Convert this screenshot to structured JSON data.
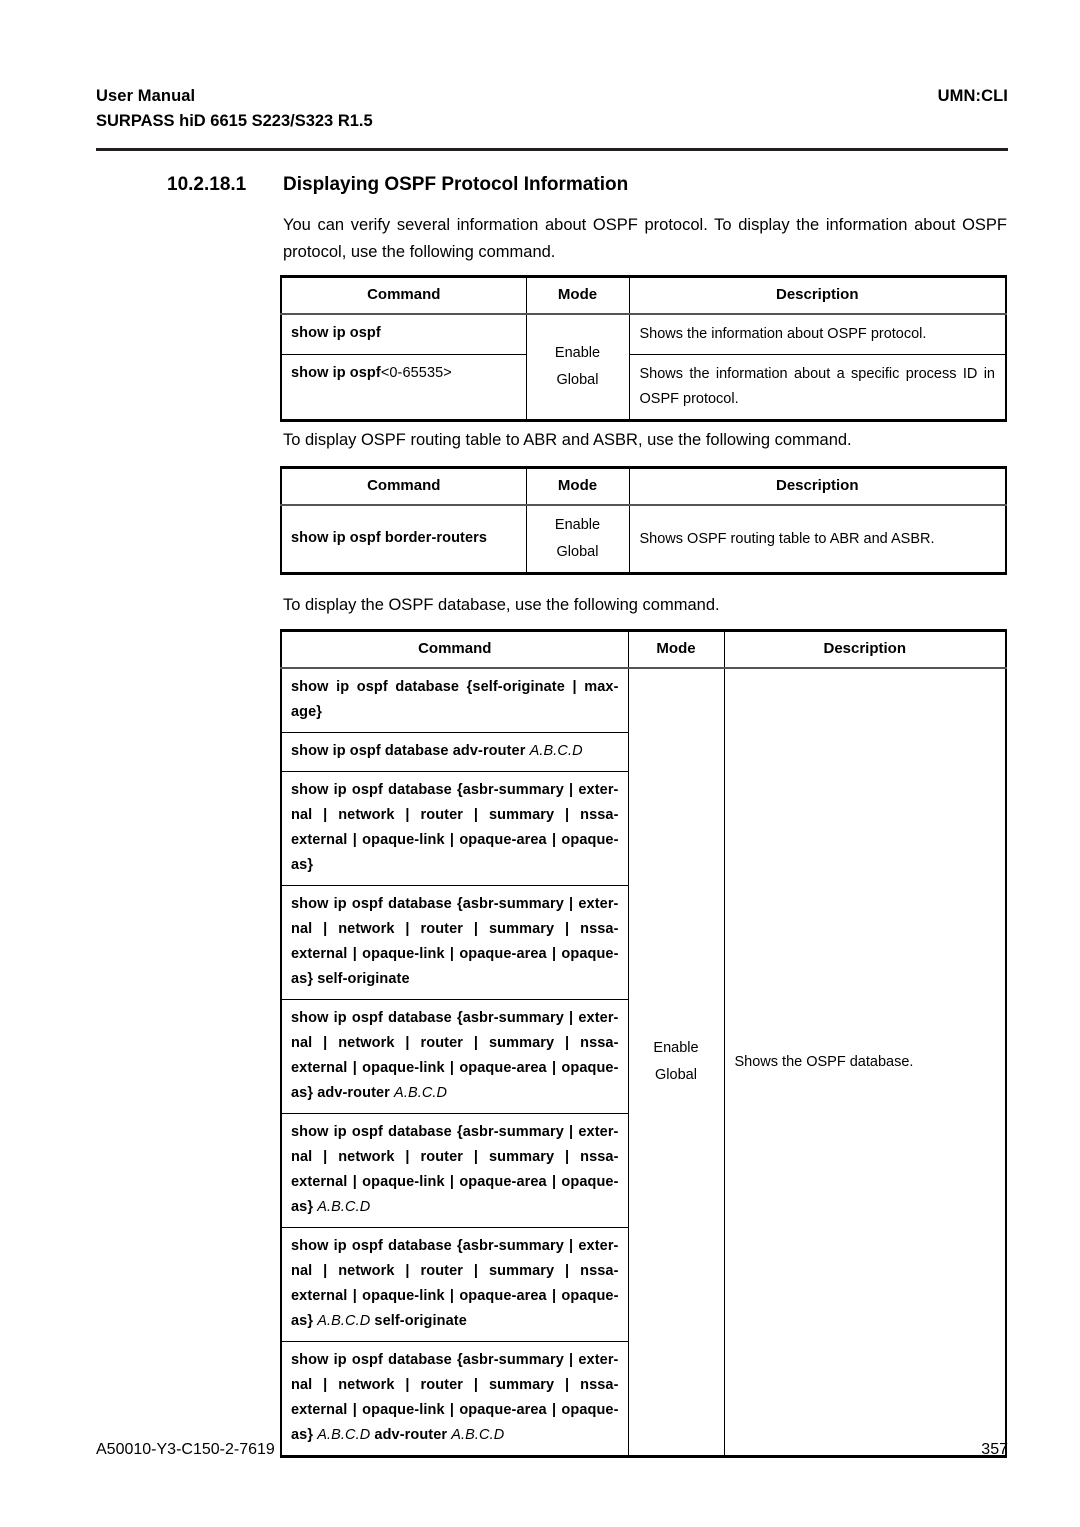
{
  "header": {
    "left_line1": "User  Manual",
    "left_line2": "SURPASS hiD 6615 S223/S323 R1.5",
    "right": "UMN:CLI"
  },
  "section": {
    "number": "10.2.18.1",
    "title": "Displaying OSPF Protocol Information"
  },
  "paragraphs": {
    "intro": "You can verify several information about OSPF protocol. To display the information about OSPF protocol, use the following command.",
    "border_routers": "To display OSPF routing table to ABR and ASBR, use the following command.",
    "database": "To display the OSPF database, use the following command."
  },
  "table_headers": {
    "command": "Command",
    "mode": "Mode",
    "description": "Description"
  },
  "table_1": {
    "rows": [
      {
        "command_bold": "show ip ospf",
        "command_plain": "",
        "description": "Shows the information about OSPF protocol."
      },
      {
        "command_bold": "show ip ospf",
        "command_plain": "<0-65535>",
        "description": "Shows the information about a specific process ID in OSPF protocol."
      }
    ],
    "mode_line1": "Enable",
    "mode_line2": "Global"
  },
  "table_2": {
    "rows": [
      {
        "command_bold": "show ip ospf border-routers",
        "description": "Shows OSPF routing table to ABR and ASBR."
      }
    ],
    "mode_line1": "Enable",
    "mode_line2": "Global"
  },
  "table_3": {
    "mode_line1": "Enable",
    "mode_line2": "Global",
    "description": "Shows the OSPF database.",
    "rows": [
      {
        "bold": "show  ip  ospf  database  {self-originate  |  max-age}",
        "ital": "",
        "bold2": "",
        "ital2": ""
      },
      {
        "bold": "show ip ospf database adv-router ",
        "ital": "A.B.C.D",
        "bold2": "",
        "ital2": ""
      },
      {
        "bold": "show ip ospf database {asbr-summary | exter-nal  |  network  |  router  |  summary  |  nssa-external | opaque-link | opaque-area | opaque-as}",
        "ital": "",
        "bold2": "",
        "ital2": ""
      },
      {
        "bold": "show ip ospf database {asbr-summary | exter-nal  |  network  |  router  |  summary  |  nssa-external | opaque-link | opaque-area | opaque-as} self-originate",
        "ital": "",
        "bold2": "",
        "ital2": ""
      },
      {
        "bold": "show ip ospf database {asbr-summary | exter-nal  |  network  |  router  |  summary  |  nssa-external | opaque-link | opaque-area | opaque-as} adv-router ",
        "ital": "A.B.C.D",
        "bold2": "",
        "ital2": ""
      },
      {
        "bold": "show ip ospf database {asbr-summary | exter-nal  |  network  |  router  |  summary  |  nssa-external | opaque-link | opaque-area | opaque-as} ",
        "ital": "A.B.C.D",
        "bold2": "",
        "ital2": ""
      },
      {
        "bold": "show ip ospf database {asbr-summary | exter-nal  |  network  |  router  |  summary  |  nssa-external | opaque-link | opaque-area | opaque-as} ",
        "ital": "A.B.C.D",
        "bold2": " self-originate",
        "ital2": ""
      },
      {
        "bold": "show ip ospf database {asbr-summary | exter-nal  |  network  |  router  |  summary  |  nssa-external | opaque-link | opaque-area | opaque-as} ",
        "ital": "A.B.C.D",
        "bold2": " adv-router ",
        "ital2": "A.B.C.D"
      }
    ]
  },
  "footer": {
    "doc_id": "A50010-Y3-C150-2-7619",
    "page_number": "357"
  }
}
